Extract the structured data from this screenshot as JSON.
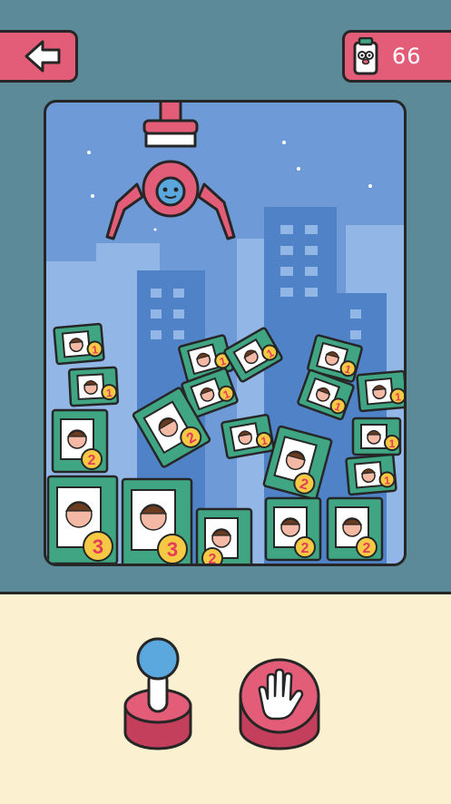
{
  "header": {
    "back_icon": "arrow-left-icon",
    "coin_icon": "capsule-mascot-icon",
    "coin_count": "66"
  },
  "machine": {
    "claw_icon": "claw-grabber-icon",
    "background": "city-skyline-night"
  },
  "boxes": [
    {
      "number": "1"
    },
    {
      "number": "1"
    },
    {
      "number": "2"
    },
    {
      "number": "3"
    },
    {
      "number": "1"
    },
    {
      "number": "1"
    },
    {
      "number": "1"
    },
    {
      "number": "1"
    },
    {
      "number": "2"
    },
    {
      "number": "1"
    },
    {
      "number": "1"
    },
    {
      "number": "2"
    },
    {
      "number": "1"
    },
    {
      "number": "1"
    },
    {
      "number": "1"
    },
    {
      "number": "3"
    },
    {
      "number": "2"
    },
    {
      "number": "2"
    },
    {
      "number": "2"
    }
  ],
  "controls": {
    "joystick_icon": "joystick-icon",
    "grab_icon": "hand-grab-icon"
  },
  "colors": {
    "pink": "#e45d78",
    "teal": "#5c8a98",
    "sky": "#6f9ad8",
    "box_green": "#3fa582",
    "badge_yellow": "#f6c945",
    "cream": "#fbf0cf",
    "joystick_blue": "#5ba8df"
  }
}
